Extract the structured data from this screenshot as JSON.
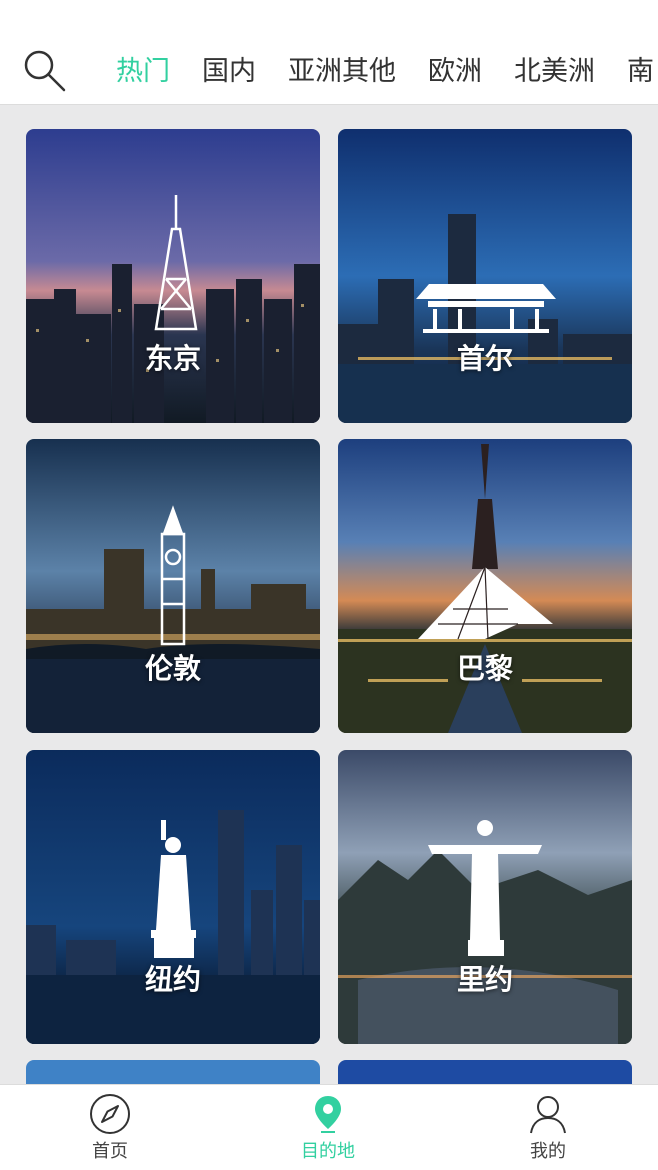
{
  "header": {
    "tabs": [
      {
        "label": "热门",
        "active": true
      },
      {
        "label": "国内",
        "active": false
      },
      {
        "label": "亚洲其他",
        "active": false
      },
      {
        "label": "欧洲",
        "active": false
      },
      {
        "label": "北美洲",
        "active": false
      },
      {
        "label": "南",
        "active": false
      }
    ],
    "search_icon": "search-icon",
    "accent_color": "#32d0a0"
  },
  "destinations": [
    {
      "label": "东京",
      "icon": "tokyo-tower-icon"
    },
    {
      "label": "首尔",
      "icon": "korean-palace-icon"
    },
    {
      "label": "伦敦",
      "icon": "big-ben-icon"
    },
    {
      "label": "巴黎",
      "icon": "eiffel-louvre-icon"
    },
    {
      "label": "纽约",
      "icon": "statue-of-liberty-icon"
    },
    {
      "label": "里约",
      "icon": "christ-redeemer-icon"
    }
  ],
  "bottom_nav": [
    {
      "label": "首页",
      "icon": "compass-icon",
      "active": false
    },
    {
      "label": "目的地",
      "icon": "location-pin-icon",
      "active": true
    },
    {
      "label": "我的",
      "icon": "user-icon",
      "active": false
    }
  ]
}
